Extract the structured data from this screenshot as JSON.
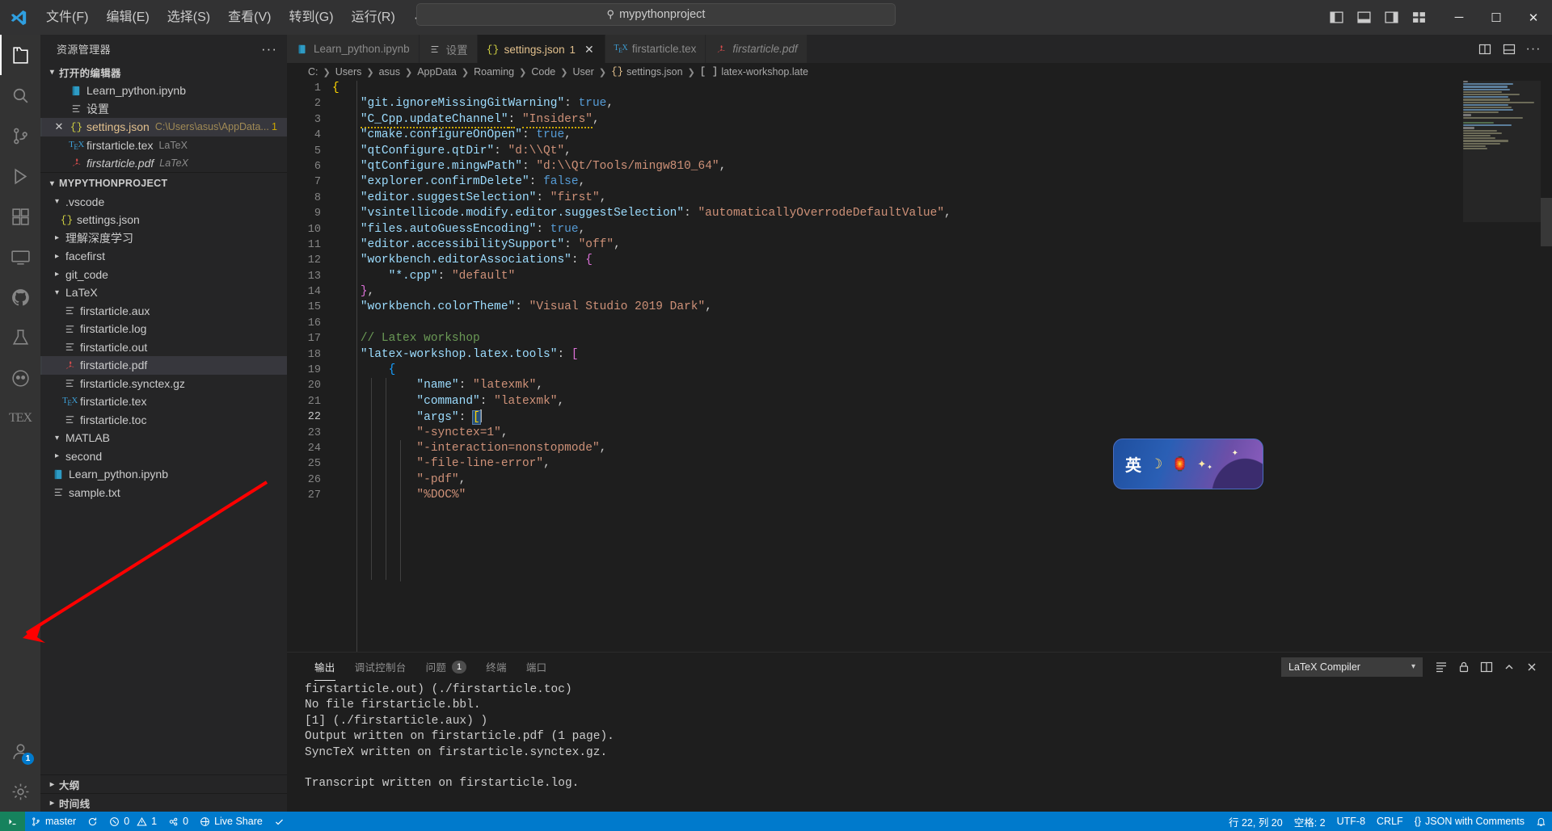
{
  "titlebar": {
    "menu": [
      "文件(F)",
      "编辑(E)",
      "选择(S)",
      "查看(V)",
      "转到(G)",
      "运行(R)"
    ],
    "menu_more": "···",
    "back_icon": "arrow-left-icon",
    "forward_icon": "arrow-right-icon",
    "search_icon": "search-icon",
    "search_value": "mypythonproject",
    "minimize": "─",
    "maximize": "☐",
    "close": "✕"
  },
  "activitybar": {
    "items": [
      {
        "name": "explorer",
        "icon": "files-icon",
        "active": true
      },
      {
        "name": "search",
        "icon": "search-icon",
        "active": false
      },
      {
        "name": "source-control",
        "icon": "source-control-icon",
        "active": false
      },
      {
        "name": "run-debug",
        "icon": "run-debug-icon",
        "active": false
      },
      {
        "name": "extensions",
        "icon": "extensions-icon",
        "active": false
      },
      {
        "name": "remote-explorer",
        "icon": "remote-explorer-icon",
        "active": false
      },
      {
        "name": "github",
        "icon": "github-icon",
        "active": false
      },
      {
        "name": "testing",
        "icon": "beaker-icon",
        "active": false
      },
      {
        "name": "copilot",
        "icon": "copilot-icon",
        "active": false
      },
      {
        "name": "latex-workshop",
        "icon": "tex-icon",
        "active": false,
        "label": "TEX"
      }
    ],
    "accounts": {
      "icon": "account-icon",
      "badge": "1"
    },
    "settings": {
      "icon": "gear-icon"
    }
  },
  "sidebar": {
    "title": "资源管理器",
    "more_icon": "more-actions-icon",
    "open_editors": {
      "label": "打开的编辑器",
      "items": [
        {
          "name": "Learn_python.ipynb",
          "icon": "notebook-icon",
          "desc": "",
          "closable": false,
          "selected": false
        },
        {
          "name": "设置",
          "icon": "settings-file-icon",
          "desc": "",
          "closable": false,
          "selected": false
        },
        {
          "name": "settings.json",
          "icon": "json-icon",
          "desc": "C:\\Users\\asus\\AppData...",
          "closable": true,
          "selected": true,
          "badge": "1"
        },
        {
          "name": "firstarticle.tex",
          "icon": "tex-icon",
          "desc": "LaTeX",
          "closable": false,
          "selected": false
        },
        {
          "name": "firstarticle.pdf",
          "icon": "pdf-icon",
          "desc": "LaTeX",
          "closable": false,
          "selected": false,
          "italic": true
        }
      ]
    },
    "project": {
      "label": "MYPYTHONPROJECT",
      "items": [
        {
          "name": ".vscode",
          "type": "folder",
          "expanded": true,
          "depth": 1
        },
        {
          "name": "settings.json",
          "type": "json",
          "depth": 2
        },
        {
          "name": "理解深度学习",
          "type": "folder",
          "expanded": false,
          "depth": 1
        },
        {
          "name": "facefirst",
          "type": "folder",
          "expanded": false,
          "depth": 1
        },
        {
          "name": "git_code",
          "type": "folder",
          "expanded": false,
          "depth": 1
        },
        {
          "name": "LaTeX",
          "type": "folder",
          "expanded": true,
          "depth": 1
        },
        {
          "name": "firstarticle.aux",
          "type": "file",
          "depth": 2
        },
        {
          "name": "firstarticle.log",
          "type": "file",
          "depth": 2
        },
        {
          "name": "firstarticle.out",
          "type": "file",
          "depth": 2
        },
        {
          "name": "firstarticle.pdf",
          "type": "pdf",
          "depth": 2,
          "selected": true
        },
        {
          "name": "firstarticle.synctex.gz",
          "type": "file",
          "depth": 2
        },
        {
          "name": "firstarticle.tex",
          "type": "tex",
          "depth": 2
        },
        {
          "name": "firstarticle.toc",
          "type": "file",
          "depth": 2
        },
        {
          "name": "MATLAB",
          "type": "folder",
          "expanded": true,
          "depth": 1
        },
        {
          "name": "second",
          "type": "folder",
          "expanded": false,
          "depth": 1
        },
        {
          "name": "Learn_python.ipynb",
          "type": "notebook",
          "depth": 1
        },
        {
          "name": "sample.txt",
          "type": "file",
          "depth": 1
        }
      ]
    },
    "outline_label": "大纲",
    "timeline_label": "时间线"
  },
  "tabs": [
    {
      "label": "Learn_python.ipynb",
      "icon": "notebook-icon",
      "active": false
    },
    {
      "label": "设置",
      "icon": "settings-file-icon",
      "active": false
    },
    {
      "label": "settings.json",
      "icon": "json-icon",
      "active": true,
      "badge": "1",
      "close": "✕"
    },
    {
      "label": "firstarticle.tex",
      "icon": "tex-icon",
      "active": false
    },
    {
      "label": "firstarticle.pdf",
      "icon": "pdf-icon",
      "active": false,
      "italic": true
    }
  ],
  "tabbar_actions": [
    {
      "name": "split-editor-icon"
    },
    {
      "name": "layout-editor-icon"
    },
    {
      "name": "more-actions-icon"
    }
  ],
  "breadcrumb": [
    "C:",
    "Users",
    "asus",
    "AppData",
    "Roaming",
    "Code",
    "User",
    "settings.json",
    "latex-workshop.late"
  ],
  "breadcrumb_json_icon": "{}",
  "breadcrumb_array_icon": "[ ]",
  "editor": {
    "line_count": 27,
    "lines": [
      {
        "n": 1,
        "text": "{"
      },
      {
        "n": 2,
        "text": "    \"git.ignoreMissingGitWarning\": true,"
      },
      {
        "n": 3,
        "text": "    \"C_Cpp.updateChannel\": \"Insiders\","
      },
      {
        "n": 4,
        "text": "    \"cmake.configureOnOpen\": true,"
      },
      {
        "n": 5,
        "text": "    \"qtConfigure.qtDir\": \"d:\\\\Qt\","
      },
      {
        "n": 6,
        "text": "    \"qtConfigure.mingwPath\": \"d:\\\\Qt/Tools/mingw810_64\","
      },
      {
        "n": 7,
        "text": "    \"explorer.confirmDelete\": false,"
      },
      {
        "n": 8,
        "text": "    \"editor.suggestSelection\": \"first\","
      },
      {
        "n": 9,
        "text": "    \"vsintellicode.modify.editor.suggestSelection\": \"automaticallyOverrodeDefaultValue\","
      },
      {
        "n": 10,
        "text": "    \"files.autoGuessEncoding\": true,"
      },
      {
        "n": 11,
        "text": "    \"editor.accessibilitySupport\": \"off\","
      },
      {
        "n": 12,
        "text": "    \"workbench.editorAssociations\": {"
      },
      {
        "n": 13,
        "text": "        \"*.cpp\": \"default\""
      },
      {
        "n": 14,
        "text": "    },"
      },
      {
        "n": 15,
        "text": "    \"workbench.colorTheme\": \"Visual Studio 2019 Dark\","
      },
      {
        "n": 16,
        "text": ""
      },
      {
        "n": 17,
        "text": "    // Latex workshop"
      },
      {
        "n": 18,
        "text": "    \"latex-workshop.latex.tools\": ["
      },
      {
        "n": 19,
        "text": "        {"
      },
      {
        "n": 20,
        "text": "            \"name\": \"latexmk\","
      },
      {
        "n": 21,
        "text": "            \"command\": \"latexmk\","
      },
      {
        "n": 22,
        "text": "            \"args\": ["
      },
      {
        "n": 23,
        "text": "            \"-synctex=1\","
      },
      {
        "n": 24,
        "text": "            \"-interaction=nonstopmode\","
      },
      {
        "n": 25,
        "text": "            \"-file-line-error\","
      },
      {
        "n": 26,
        "text": "            \"-pdf\","
      },
      {
        "n": 27,
        "text": "            \"%DOC%\""
      }
    ],
    "cursor_line": 22
  },
  "panel": {
    "tabs": [
      {
        "label": "输出",
        "active": true
      },
      {
        "label": "调试控制台",
        "active": false
      },
      {
        "label": "问题",
        "active": false,
        "badge": "1"
      },
      {
        "label": "终端",
        "active": false
      },
      {
        "label": "端口",
        "active": false
      }
    ],
    "select_value": "LaTeX Compiler",
    "select_chevron": "▾",
    "actions": [
      {
        "name": "clear-output-icon"
      },
      {
        "name": "lock-icon"
      },
      {
        "name": "split-panel-icon"
      },
      {
        "name": "maximize-panel-icon"
      },
      {
        "name": "close-panel-icon"
      }
    ],
    "output_lines": [
      "firstarticle.out) (./firstarticle.toc)",
      "No file firstarticle.bbl.",
      "[1] (./firstarticle.aux) )",
      "Output written on firstarticle.pdf (1 page).",
      "SyncTeX written on firstarticle.synctex.gz.",
      "",
      "Transcript written on firstarticle.log."
    ]
  },
  "statusbar": {
    "remote_icon": "remote-indicator-icon",
    "branch_icon": "source-control-icon",
    "branch": "master",
    "sync_icon": "sync-icon",
    "error_icon": "error-icon",
    "errors": "0",
    "warning_icon": "warning-icon",
    "warnings": "1",
    "ports_icon": "ports-icon",
    "ports": "0",
    "live_share_icon": "live-share-icon",
    "live_share": "Live Share",
    "check_icon": "check-icon",
    "cursor_position": "行 22, 列 20",
    "indentation": "空格: 2",
    "encoding": "UTF-8",
    "eol": "CRLF",
    "language_icon": "{}",
    "language": "JSON with Comments",
    "bell_icon": "bell-icon"
  },
  "ime_widget": {
    "mode": "英",
    "moon": "☽",
    "lantern": "🏮",
    "star": "✦"
  },
  "colors": {
    "accent": "#007acc",
    "titlebar_bg": "#323233",
    "sidebar_bg": "#252526",
    "editor_bg": "#1e1e1e",
    "activitybar_bg": "#333333",
    "string": "#ce9178",
    "key": "#9cdcfe",
    "boolean": "#569cd6",
    "comment": "#6a9955",
    "modified": "#e2c08d",
    "warning": "#cca700",
    "arrow_annotation": "#ff0000"
  }
}
